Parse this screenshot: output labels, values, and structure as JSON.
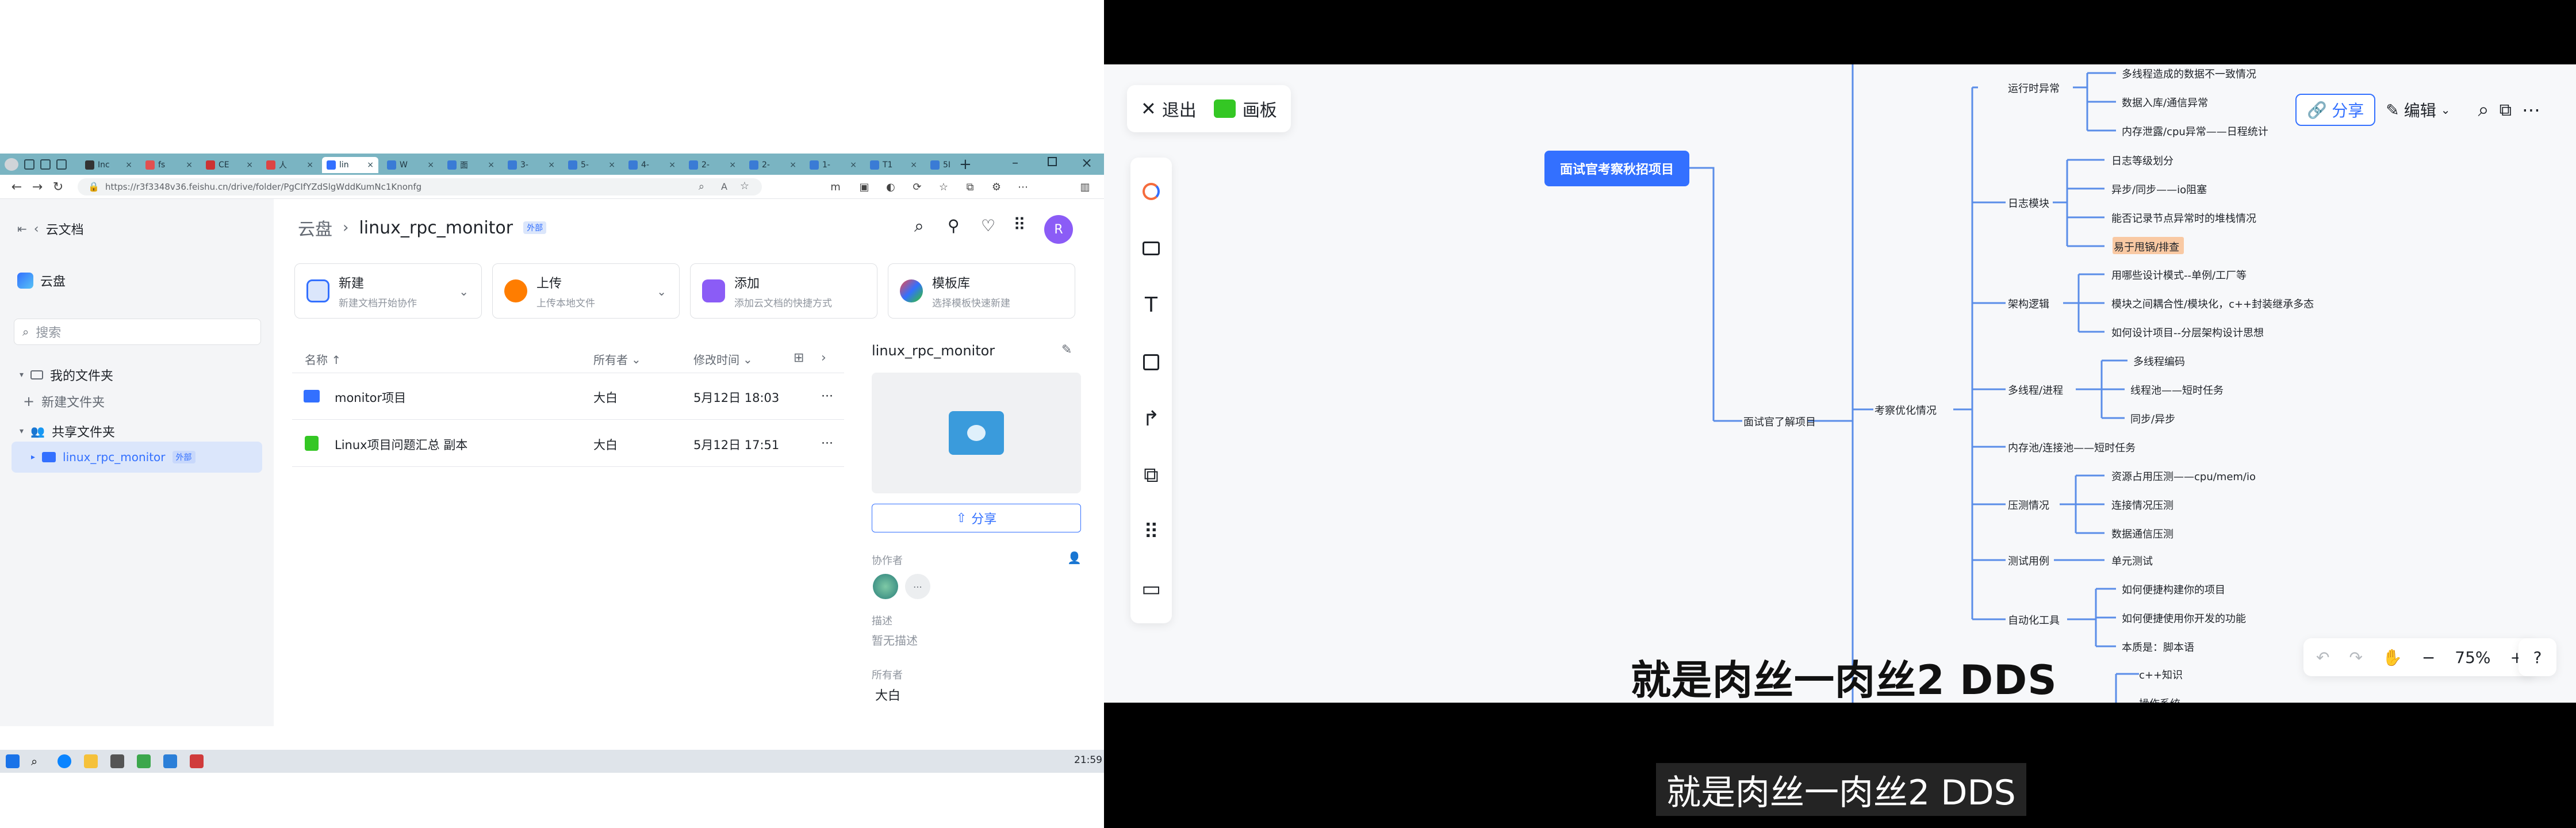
{
  "browser": {
    "tabs": [
      "Inc",
      "fs",
      "CE",
      "人",
      "lin",
      "W",
      "面",
      "3-",
      "5-",
      "4-",
      "2-",
      "2-",
      "1-",
      "T1",
      "5I"
    ],
    "active_tab_index": 4,
    "url": "https://r3f3348v36.feishu.cn/drive/folder/PgCIfYZdSlgWddKumNc1Knonfg"
  },
  "sidebar": {
    "back_label": "云文档",
    "space_label": "云盘",
    "search_placeholder": "搜索",
    "my_folder": "我的文件夹",
    "new_folder": "新建文件夹",
    "shared_folder": "共享文件夹",
    "shared_item": "linux_rpc_monitor",
    "shared_item_badge": "外部"
  },
  "header": {
    "breadcrumb_root": "云盘",
    "breadcrumb_current": "linux_rpc_monitor",
    "badge": "外部",
    "avatar": "R"
  },
  "cards": [
    {
      "title": "新建",
      "sub": "新建文档开始协作"
    },
    {
      "title": "上传",
      "sub": "上传本地文件"
    },
    {
      "title": "添加",
      "sub": "添加云文档的快捷方式"
    },
    {
      "title": "模板库",
      "sub": "选择模板快速新建"
    }
  ],
  "table": {
    "col_name": "名称 ↑",
    "col_owner": "所有者",
    "col_time": "修改时间",
    "rows": [
      {
        "name": "monitor项目",
        "owner": "大白",
        "time": "5月12日 18:03"
      },
      {
        "name": "Linux项目问题汇总 副本",
        "owner": "大白",
        "time": "5月12日 17:51"
      }
    ]
  },
  "details": {
    "title": "linux_rpc_monitor",
    "share_label": "分享",
    "collaborators_label": "协作者",
    "desc_label": "描述",
    "desc_value": "暂无描述",
    "owner_label": "所有者",
    "owner_value": "大白"
  },
  "taskbar": {
    "time": "21:59"
  },
  "whiteboard": {
    "exit_label": "退出",
    "board_label": "画板",
    "share_label": "分享",
    "edit_label": "编辑",
    "zoom": "75%",
    "root_node": "面试官考察秋招项目",
    "branch_node": "面试官了解项目",
    "sub_node": "考察优化情况",
    "groups": {
      "runtime": "运行时异常",
      "log": "日志模块",
      "arch": "架构逻辑",
      "thread": "多线程/进程",
      "pool": "内存池/连接池——短时任务",
      "stress": "压测情况",
      "test": "测试用例",
      "auto": "自动化工具"
    },
    "leaves": {
      "r1": "多线程造成的数据不一致情况",
      "r2": "数据入库/通信异常",
      "r3": "内存泄露/cpu异常——日程统计",
      "l1": "日志等级划分",
      "l2": "异步/同步——io阻塞",
      "l3": "能否记录节点异常时的堆栈情况",
      "l4": "易于甩锅/排查",
      "a1": "用哪些设计模式--单例/工厂等",
      "a2": "模块之间耦合性/模块化，c++封装继承多态",
      "a3": "如何设计项目--分层架构设计思想",
      "t1": "多线程编码",
      "t2": "线程池——短时任务",
      "t3": "同步/异步",
      "s1": "资源占用压测——cpu/mem/io",
      "s2": "连接情况压测",
      "s3": "数据通信压测",
      "u1": "单元测试",
      "au1": "如何便捷构建你的项目",
      "au2": "如何便捷使用你开发的功能",
      "au3": "本质是：脚本语",
      "c1": "c++知识",
      "c2": "操作系统"
    },
    "subtitle": "就是肉丝一肉丝2 DDS"
  },
  "caption": "就是肉丝一肉丝2 DDS",
  "colors": {
    "accent": "#3370ff",
    "tabstrip": "#7ab4c2",
    "sidebar": "#f4f5f7",
    "avatar": "#8b5cf6",
    "highlight": "#f9c9a3",
    "mindmap_line": "#5a8de8"
  }
}
